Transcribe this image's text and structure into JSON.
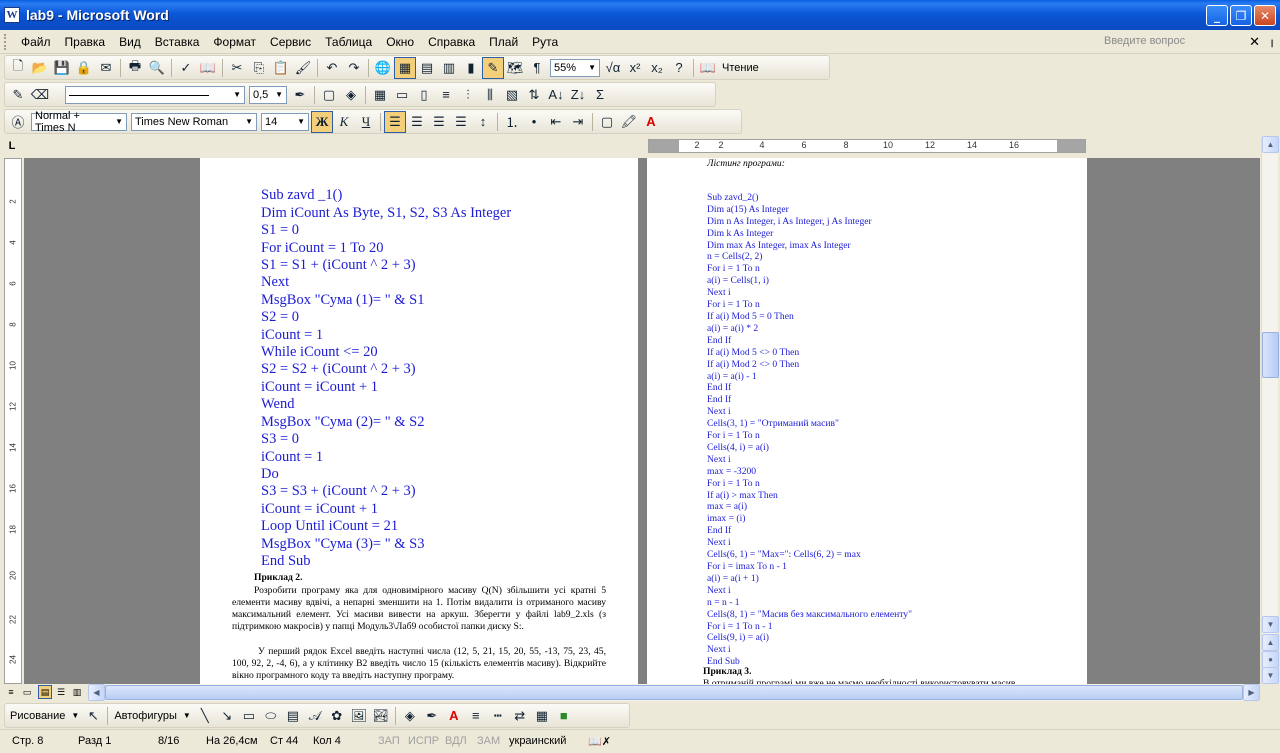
{
  "window": {
    "title": "lab9 - Microsoft Word",
    "app_icon": "W"
  },
  "menu": [
    "Файл",
    "Правка",
    "Вид",
    "Вставка",
    "Формат",
    "Сервис",
    "Таблица",
    "Окно",
    "Справка",
    "Плай",
    "Рута"
  ],
  "help_search": {
    "placeholder": "Введите вопрос"
  },
  "standard_toolbar": {
    "zoom": "55%",
    "reading_label": "Чтение"
  },
  "formatting_toolbar": {
    "style": "Normal + Times N",
    "font": "Times New Roman",
    "font_size": "14",
    "bold": "Ж",
    "italic": "К",
    "underline": "Ч"
  },
  "tables_toolbar": {
    "line_width": "0,5"
  },
  "ruler": {
    "ticks": [
      "2",
      "2",
      "4",
      "6",
      "8",
      "10",
      "12",
      "14",
      "16"
    ],
    "vticks": [
      "2",
      "4",
      "6",
      "8",
      "10",
      "12",
      "14",
      "16",
      "18",
      "20",
      "22",
      "24"
    ],
    "corner": "L"
  },
  "left_page": {
    "code": [
      "Sub zavd _1()",
      "Dim iCount As Byte, S1, S2, S3 As Integer",
      "S1 = 0",
      "For iCount = 1 To 20",
      "S1 = S1 + (iCount ^ 2 + 3)",
      "Next",
      "MsgBox \"Сума (1)= \" & S1",
      "S2 = 0",
      "iCount = 1",
      "While iCount <= 20",
      "S2 = S2 + (iCount ^ 2 + 3)",
      "iCount = iCount + 1",
      "Wend",
      "MsgBox \"Сума (2)= \" & S2",
      "S3 = 0",
      "iCount = 1",
      "Do",
      "S3 = S3 + (iCount ^ 2 + 3)",
      "iCount = iCount + 1",
      "Loop Until iCount = 21",
      "MsgBox \"Сума (3)= \" & S3",
      "End Sub"
    ],
    "example2_title": "Приклад 2.",
    "example2_text": "Розробити програму яка для одновимірного масиву Q(N) збільшити усі кратні 5 елементи масиву вдвічі, а непарні зменшити на 1. Потім видалити із отриманого масиву максимальний елемент. Усі масиви вивести на аркуш. Зберегти у файлі lab9_2.xls (з підтримкою макросів) у папці Модуль3\\Лаб9 особистої папки диску S:.",
    "example2_text2": "У перший рядок Excel введіть наступні числа (12, 5, 21, 15, 20, 55, -13, 75, 23, 45, 100, 92, 2, -4, 6), а у клітинку B2 введіть число 15 (кількість елементів масиву). Відкрийте вікно програмного коду та введіть наступну програму."
  },
  "right_page": {
    "listing_title": "Лістинг програми:",
    "code": [
      "Sub zavd_2()",
      "Dim a(15) As Integer",
      "Dim n As Integer, i As Integer, j As Integer",
      "Dim k As Integer",
      "Dim max As Integer, imax As Integer",
      "n = Cells(2, 2)",
      "For i = 1 To n",
      "a(i) = Cells(1, i)",
      "Next i",
      "For i = 1 To n",
      "If a(i) Mod 5 = 0 Then",
      "a(i) = a(i) * 2",
      "End If",
      "If a(i) Mod 5 <> 0 Then",
      "If a(i) Mod 2 <> 0 Then",
      "a(i) = a(i) - 1",
      "End If",
      "End If",
      "Next i",
      "Cells(3, 1) = \"Отриманий масив\"",
      "For i = 1 To n",
      "Cells(4, i) = a(i)",
      "Next i",
      "max = -3200",
      "For i = 1 To n",
      "If a(i) > max Then",
      "max = a(i)",
      "imax = (i)",
      "End If",
      "Next i",
      "Cells(6, 1) = \"Max=\": Cells(6, 2) = max",
      "For i = imax To n - 1",
      "a(i) = a(i + 1)",
      "Next i",
      "n = n - 1",
      "Cells(8, 1) = \"Масив без максимального елементу\"",
      "For i = 1 To n - 1",
      "Cells(9, i) = a(i)",
      "Next i",
      "End Sub"
    ],
    "example3_title": "Приклад 3.",
    "example3_tail": "В отриманій програмі ми вже не маємо необхідності використовувати масив"
  },
  "drawing_toolbar": {
    "draw_label": "Рисование",
    "autoshapes_label": "Автофигуры"
  },
  "status": {
    "page": "Стр. 8",
    "section": "Разд 1",
    "pages": "8/16",
    "at": "На 26,4см",
    "line": "Ст 44",
    "col": "Кол 4",
    "rec": "ЗАП",
    "trk": "ИСПР",
    "ext": "ВДЛ",
    "ovr": "ЗАМ",
    "language": "украинский"
  }
}
